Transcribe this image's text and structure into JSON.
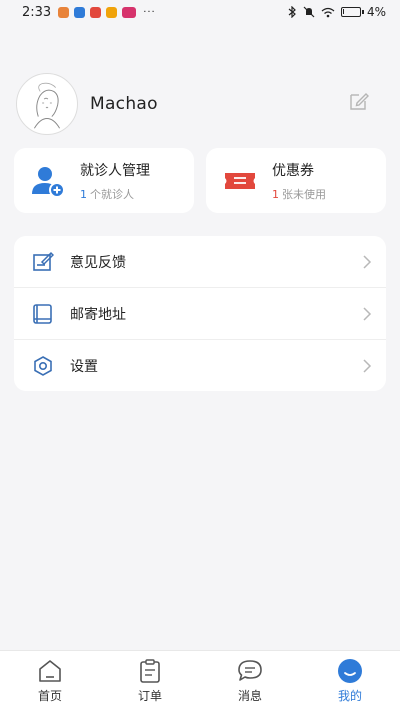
{
  "status_bar": {
    "time": "2:33",
    "more_indicator": "···",
    "battery": "4%",
    "battery_level": 0.04,
    "app_icon_colors": [
      "#e8833a",
      "#2f7bd8",
      "#e2483d",
      "#f0a30a",
      "#d6336c"
    ]
  },
  "profile": {
    "username": "Machao",
    "avatar_icon": "avatar-sketch",
    "edit_icon": "edit-icon"
  },
  "cards": {
    "patients": {
      "title": "就诊人管理",
      "count": "1",
      "suffix": "个就诊人",
      "icon": "user-add-icon"
    },
    "coupons": {
      "title": "优惠券",
      "count": "1",
      "suffix": "张未使用",
      "icon": "ticket-icon"
    }
  },
  "menu": {
    "items": [
      {
        "label": "意见反馈",
        "icon": "feedback-icon"
      },
      {
        "label": "邮寄地址",
        "icon": "book-icon"
      },
      {
        "label": "设置",
        "icon": "settings-icon"
      }
    ]
  },
  "bottom_nav": {
    "items": [
      {
        "label": "首页",
        "icon": "home-icon",
        "active": false
      },
      {
        "label": "订单",
        "icon": "clipboard-icon",
        "active": false
      },
      {
        "label": "消息",
        "icon": "message-icon",
        "active": false
      },
      {
        "label": "我的",
        "icon": "profile-icon",
        "active": true
      }
    ]
  },
  "colors": {
    "accent": "#2f7bd8",
    "coupon": "#e2483d",
    "background": "#f5f5f7"
  }
}
